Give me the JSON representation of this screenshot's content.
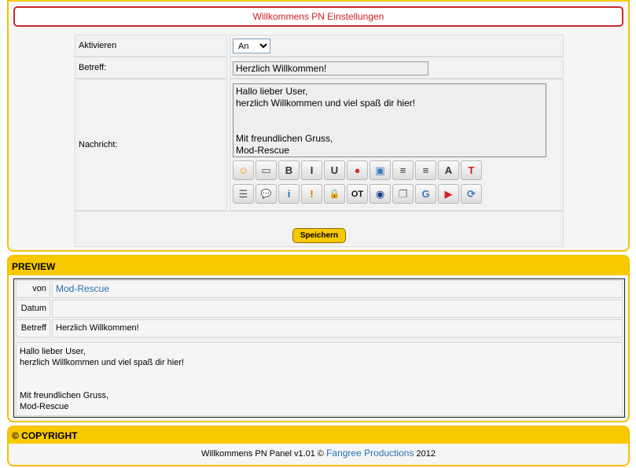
{
  "settings": {
    "title": "Willkommens PN Einstellungen",
    "aktivieren_label": "Aktivieren",
    "aktivieren_value": "An",
    "betreff_label": "Betreff:",
    "betreff_value": "Herzlich Willkommen!",
    "nachricht_label": "Nachricht:",
    "message_lines": [
      "Hallo lieber User,",
      "herzlich Willkommen und viel spaß dir hier!",
      "",
      "",
      "Mit freundlichen Gruss,",
      "Mod-Rescue"
    ],
    "save_label": "Speichern"
  },
  "toolbar_row1": [
    {
      "name": "smiley-icon",
      "glyph": "☺",
      "color": "#e0a000"
    },
    {
      "name": "insert-text-icon",
      "glyph": "▭",
      "color": "#555555"
    },
    {
      "name": "bold-icon",
      "glyph": "B",
      "color": "#333333"
    },
    {
      "name": "italic-icon",
      "glyph": "I",
      "color": "#333333"
    },
    {
      "name": "underline-icon",
      "glyph": "U",
      "color": "#333333"
    },
    {
      "name": "color-icon",
      "glyph": "●",
      "color": "#cc3333"
    },
    {
      "name": "image-icon",
      "glyph": "▣",
      "color": "#3a78c0"
    },
    {
      "name": "align-center-icon",
      "glyph": "≡",
      "color": "#333333"
    },
    {
      "name": "align-right-icon",
      "glyph": "≡",
      "color": "#333333"
    },
    {
      "name": "font-size-icon",
      "glyph": "A",
      "color": "#333333"
    },
    {
      "name": "font-type-icon",
      "glyph": "T",
      "color": "#cc2222"
    }
  ],
  "toolbar_row2": [
    {
      "name": "list-icon",
      "glyph": "☰",
      "color": "#555555"
    },
    {
      "name": "quote-bubble-icon",
      "glyph": "💬",
      "color": "#3a78c0"
    },
    {
      "name": "info-icon",
      "glyph": "i",
      "color": "#1a6fc0"
    },
    {
      "name": "warning-icon",
      "glyph": "!",
      "color": "#e06a00"
    },
    {
      "name": "lock-icon",
      "glyph": "🔒",
      "color": "#e08a00"
    },
    {
      "name": "offtopic-icon",
      "glyph": "OT",
      "color": "#111111"
    },
    {
      "name": "eye-icon",
      "glyph": "◉",
      "color": "#1a3f8a"
    },
    {
      "name": "speech-icon",
      "glyph": "❐",
      "color": "#777777"
    },
    {
      "name": "google-icon",
      "glyph": "G",
      "color": "#3a78c0"
    },
    {
      "name": "youtube-icon",
      "glyph": "▶",
      "color": "#cc2222"
    },
    {
      "name": "link-icon",
      "glyph": "⟳",
      "color": "#3a78c0"
    }
  ],
  "preview": {
    "header": "PREVIEW",
    "von_label": "von",
    "von_value": "Mod-Rescue",
    "datum_label": "Datum",
    "datum_value": "",
    "betreff_label": "Betreff",
    "betreff_value": "Herzlich Willkommen!",
    "message_lines": [
      "Hallo lieber User,",
      "herzlich Willkommen und viel spaß dir hier!",
      "",
      "",
      "Mit freundlichen Gruss,",
      "Mod-Rescue"
    ]
  },
  "copyright": {
    "header": "© COPYRIGHT",
    "text_before": "Willkommens PN Panel v1.01 ©",
    "link_text": "Fangree Productions",
    "text_after": "2012"
  }
}
